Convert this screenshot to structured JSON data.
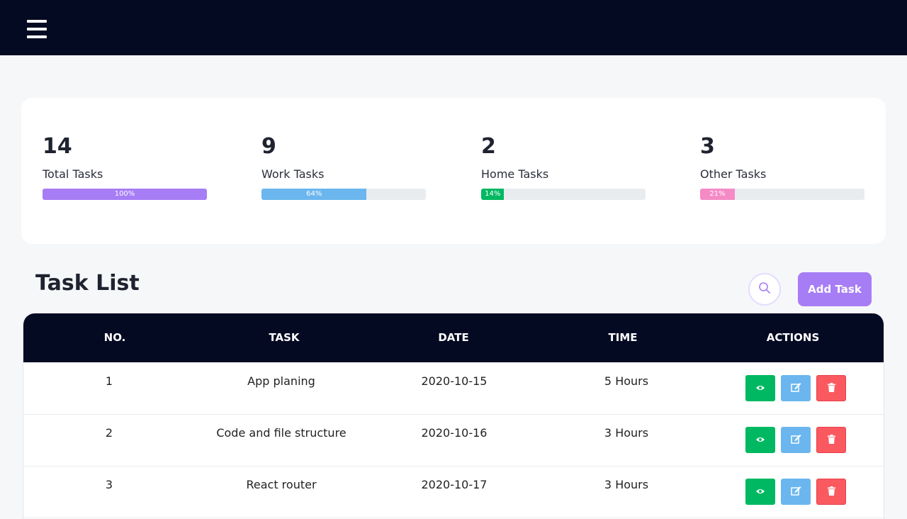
{
  "stats": [
    {
      "value": "14",
      "label": "Total Tasks",
      "percent": 100,
      "percent_label": "100%",
      "color": "#a77df5"
    },
    {
      "value": "9",
      "label": "Work Tasks",
      "percent": 64,
      "percent_label": "64%",
      "color": "#6bb6ee"
    },
    {
      "value": "2",
      "label": "Home Tasks",
      "percent": 14,
      "percent_label": "14%",
      "color": "#00b862"
    },
    {
      "value": "3",
      "label": "Other Tasks",
      "percent": 21,
      "percent_label": "21%",
      "color": "#f58ac7"
    }
  ],
  "task_list": {
    "title": "Task List",
    "add_label": "Add Task",
    "search_icon": "search-icon"
  },
  "table": {
    "headers": [
      "NO.",
      "TASK",
      "DATE",
      "TIME",
      "ACTIONS"
    ],
    "rows": [
      {
        "no": "1",
        "task": "App planing",
        "date": "2020-10-15",
        "time": "5 Hours"
      },
      {
        "no": "2",
        "task": "Code and file structure",
        "date": "2020-10-16",
        "time": "3 Hours"
      },
      {
        "no": "3",
        "task": "React router",
        "date": "2020-10-17",
        "time": "3 Hours"
      }
    ]
  },
  "colors": {
    "nav_bg": "#050a23",
    "accent": "#a77df5",
    "view": "#00b862",
    "edit": "#6bb6ee",
    "delete": "#fb5960"
  }
}
